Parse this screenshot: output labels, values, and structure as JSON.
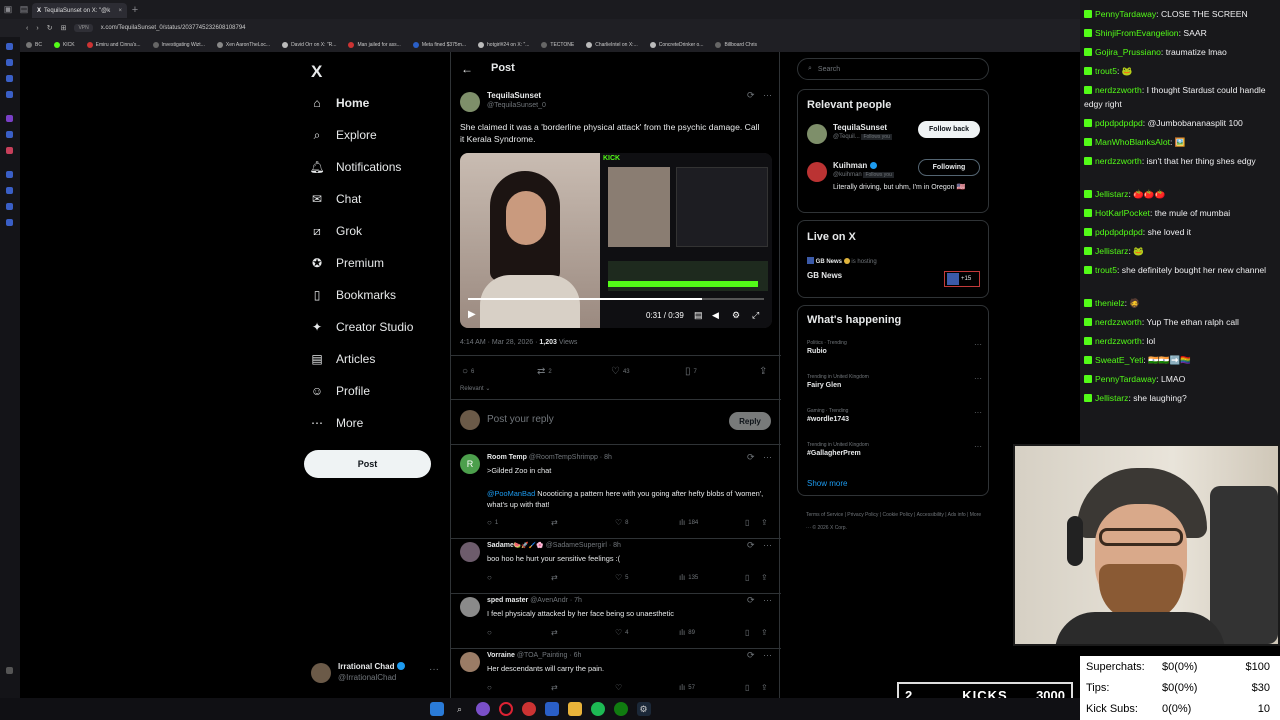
{
  "browser": {
    "tab_title": "TequilaSunset on X: \"@k",
    "url": "x.com/TequilaSunset_0/status/2037745232608108794",
    "vpn_label": "VPN",
    "bookmarks": [
      "BC",
      "KICK",
      "Emiru and Cinna's...",
      "Investigating Wizt...",
      "Xen AaronTheLoc...",
      "David Orr on X: \"R...",
      "Man jailed for ass...",
      "Meta fined $375m...",
      "hotgirl#24 on X: \"...",
      "TECTONE",
      "CharlieIntel on X:...",
      "ConcreteDrinker o...",
      "Billboard Chris"
    ]
  },
  "nav": {
    "logo": "X",
    "items": [
      "Home",
      "Explore",
      "Notifications",
      "Chat",
      "Grok",
      "Premium",
      "Bookmarks",
      "Creator Studio",
      "Articles",
      "Profile",
      "More"
    ],
    "post_button": "Post",
    "account_name": "Irrational Chad",
    "account_handle": "@IrrationalChad"
  },
  "post": {
    "header": "Post",
    "author_name": "TequilaSunset",
    "author_handle": "@TequilaSunset_0",
    "text": "She claimed it was a 'borderline physical attack' from the psychic damage. Call it Kerala Syndrome.",
    "video_time": "0:31 / 0:39",
    "kick_logo": "KICK",
    "timestamp": "4:14 AM · Mar 28, 2026 · ",
    "views_count": "1,203",
    "views_label": " Views",
    "replies": "6",
    "reposts": "2",
    "likes": "43",
    "bookmarks": "7",
    "sort": "Relevant",
    "reply_placeholder": "Post your reply",
    "reply_button": "Reply"
  },
  "replies": [
    {
      "initial": "R",
      "name": "Room Temp",
      "handle": "@RoomTempShrimpp · 8h",
      "text": ">Gilded Zoo in chat",
      "mention": "@PooManBad",
      "text2": " Noooticing a pattern here with you going after hefty blobs of 'women', what's up with that!",
      "r": "1",
      "rt": "",
      "l": "8",
      "v": "184"
    },
    {
      "name": "Sadame",
      "emoji": "🍉🚀🖌️🌸",
      "handle": "@SadameSupergirl · 8h",
      "text": "boo hoo he hurt your sensitive feelings :(",
      "r": "",
      "rt": "",
      "l": "5",
      "v": "135"
    },
    {
      "name": "sped master",
      "handle": "@AvenAndr · 7h",
      "text": "I feel physicaly attacked by her face being so unaesthetic",
      "r": "",
      "rt": "",
      "l": "4",
      "v": "89"
    },
    {
      "name": "Vorraine",
      "handle": "@TOA_Painting · 6h",
      "text": "Her descendants will carry the pain.",
      "r": "",
      "rt": "",
      "l": "",
      "v": "57"
    }
  ],
  "right": {
    "search_placeholder": "Search",
    "relevant_title": "Relevant people",
    "people": [
      {
        "name": "TequilaSunset",
        "handle": "@Tequil...",
        "follows": "Follows you",
        "button": "Follow back",
        "bio": ""
      },
      {
        "name": "Kuihman",
        "handle": "@kuihman",
        "follows": "Follows you",
        "button": "Following",
        "bio": "Literally driving, but uhm, I'm in Oregon 🇺🇸"
      }
    ],
    "live_title": "Live on X",
    "live_host": "GB News",
    "live_status": " is hosting",
    "live_name": "GB News",
    "live_count": "+15",
    "happening_title": "What's happening",
    "trends": [
      {
        "context": "Politics · Trending",
        "topic": "Rubio"
      },
      {
        "context": "Trending in United Kingdom",
        "topic": "Fairy Glen"
      },
      {
        "context": "Gaming · Trending",
        "topic": "#wordle1743"
      },
      {
        "context": "Trending in United Kingdom",
        "topic": "#GallagherPrem"
      }
    ],
    "show_more": "Show more",
    "footer": "Terms of Service  |  Privacy Policy  |  Cookie Policy  |  Accessibility  |  Ads info  |  More ···  © 2026 X Corp."
  },
  "chat": [
    {
      "user": "PennyTardaway",
      "text": "CLOSE THE SCREEN"
    },
    {
      "user": "ShinjiFromEvangelion",
      "text": "SAAR"
    },
    {
      "user": "Gojira_Prussiano",
      "text": "traumatize lmao"
    },
    {
      "user": "trout5",
      "text": "🐸"
    },
    {
      "user": "nerdzzworth",
      "text": "I thought Stardust could handle edgy right"
    },
    {
      "user": "pdpdpdpdpd",
      "text": "@Jumbobananasplit 100"
    },
    {
      "user": "ManWhoBlanksAlot",
      "text": "🖼️"
    },
    {
      "user": "nerdzzworth",
      "text": "isn't that her thing shes edgy"
    },
    {
      "user": "Jellistarz",
      "text": "🍅🍅🍅"
    },
    {
      "user": "HotKarlPocket",
      "text": "the mule of mumbai"
    },
    {
      "user": "pdpdpdpdpd",
      "text": "she loved it"
    },
    {
      "user": "Jellistarz",
      "text": "🐸"
    },
    {
      "user": "trout5",
      "text": "she definitely bought her new channel"
    },
    {
      "user": "thenielz",
      "text": "🧔"
    },
    {
      "user": "nerdzzworth",
      "text": "Yup The ethan ralph call"
    },
    {
      "user": "nerdzzworth",
      "text": "lol"
    },
    {
      "user": "SweatE_Yeti",
      "text": "🇮🇳🇮🇳➡️🏳️‍🌈"
    },
    {
      "user": "PennyTardaway",
      "text": "LMAO"
    },
    {
      "user": "Jellistarz",
      "text": "she laughing?"
    }
  ],
  "stats": {
    "superchats_label": "Superchats:",
    "superchats_val": "$0(0%)",
    "superchats_goal": "$100",
    "tips_label": "Tips:",
    "tips_val": "$0(0%)",
    "tips_goal": "$30",
    "subs_label": "Kick Subs:",
    "subs_val": "0(0%)",
    "subs_goal": "10"
  },
  "kicks": {
    "count": "2",
    "label": "KICKS",
    "goal": "3000"
  },
  "colors": {
    "kick_green": "#53fc18",
    "x_blue": "#1d9bf0",
    "chat_bg": "#18181b"
  }
}
